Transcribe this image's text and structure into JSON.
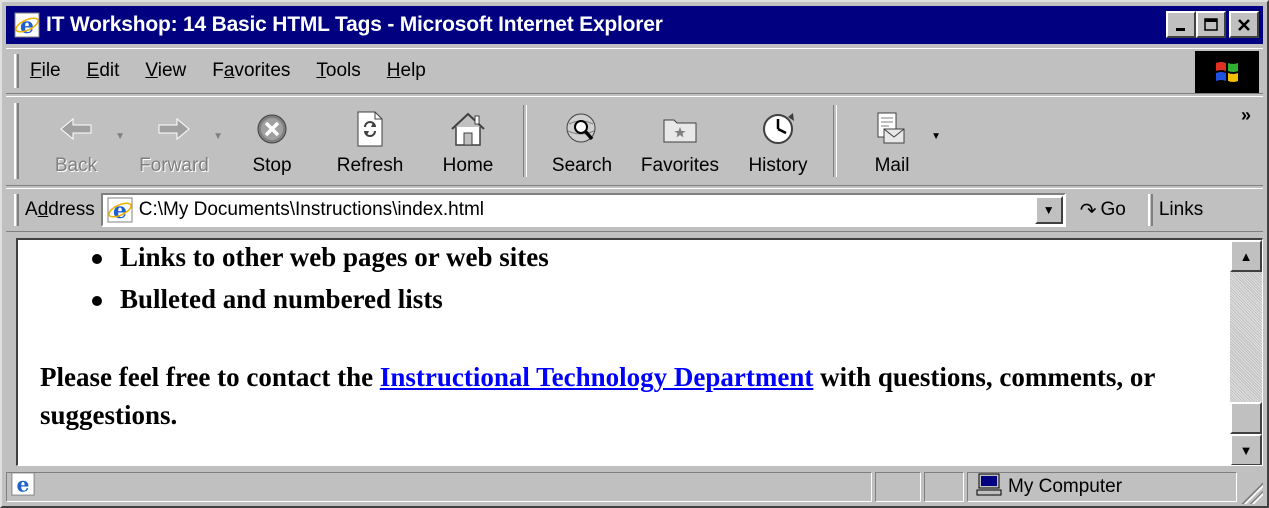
{
  "window": {
    "title": "IT Workshop: 14 Basic HTML Tags - Microsoft Internet Explorer",
    "controls": [
      "_",
      "□",
      "×"
    ]
  },
  "menu": [
    {
      "label": "File",
      "key": "F",
      "rest": "ile"
    },
    {
      "label": "Edit",
      "key": "E",
      "rest": "dit"
    },
    {
      "label": "View",
      "key": "V",
      "rest": "iew"
    },
    {
      "label": "Favorites",
      "pre": "F",
      "key": "a",
      "rest": "vorites"
    },
    {
      "label": "Tools",
      "key": "T",
      "rest": "ools"
    },
    {
      "label": "Help",
      "key": "H",
      "rest": "elp"
    }
  ],
  "toolbar": {
    "back": "Back",
    "forward": "Forward",
    "stop": "Stop",
    "refresh": "Refresh",
    "home": "Home",
    "search": "Search",
    "favorites": "Favorites",
    "history": "History",
    "mail": "Mail",
    "more": "»"
  },
  "address": {
    "label": "Address",
    "value": "C:\\My Documents\\Instructions\\index.html",
    "go": "Go",
    "links": "Links"
  },
  "page": {
    "bullets": [
      "Links to other web pages or web sites",
      "Bulleted and numbered lists"
    ],
    "contact_pre": "Please feel free to contact the ",
    "contact_link": "Instructional Technology Department",
    "contact_post": " with questions, comments, or suggestions."
  },
  "status": {
    "text": "",
    "zone": "My Computer"
  },
  "colors": {
    "titlebar": "#000080",
    "chrome": "#c0c0c0",
    "link": "#0000ff"
  },
  "icons": [
    "ie-logo-icon",
    "windows-flag-icon",
    "back-arrow-icon",
    "forward-arrow-icon",
    "stop-icon",
    "refresh-icon",
    "home-icon",
    "search-icon",
    "favorites-icon",
    "history-icon",
    "mail-icon",
    "go-arrow-icon",
    "computer-icon"
  ]
}
